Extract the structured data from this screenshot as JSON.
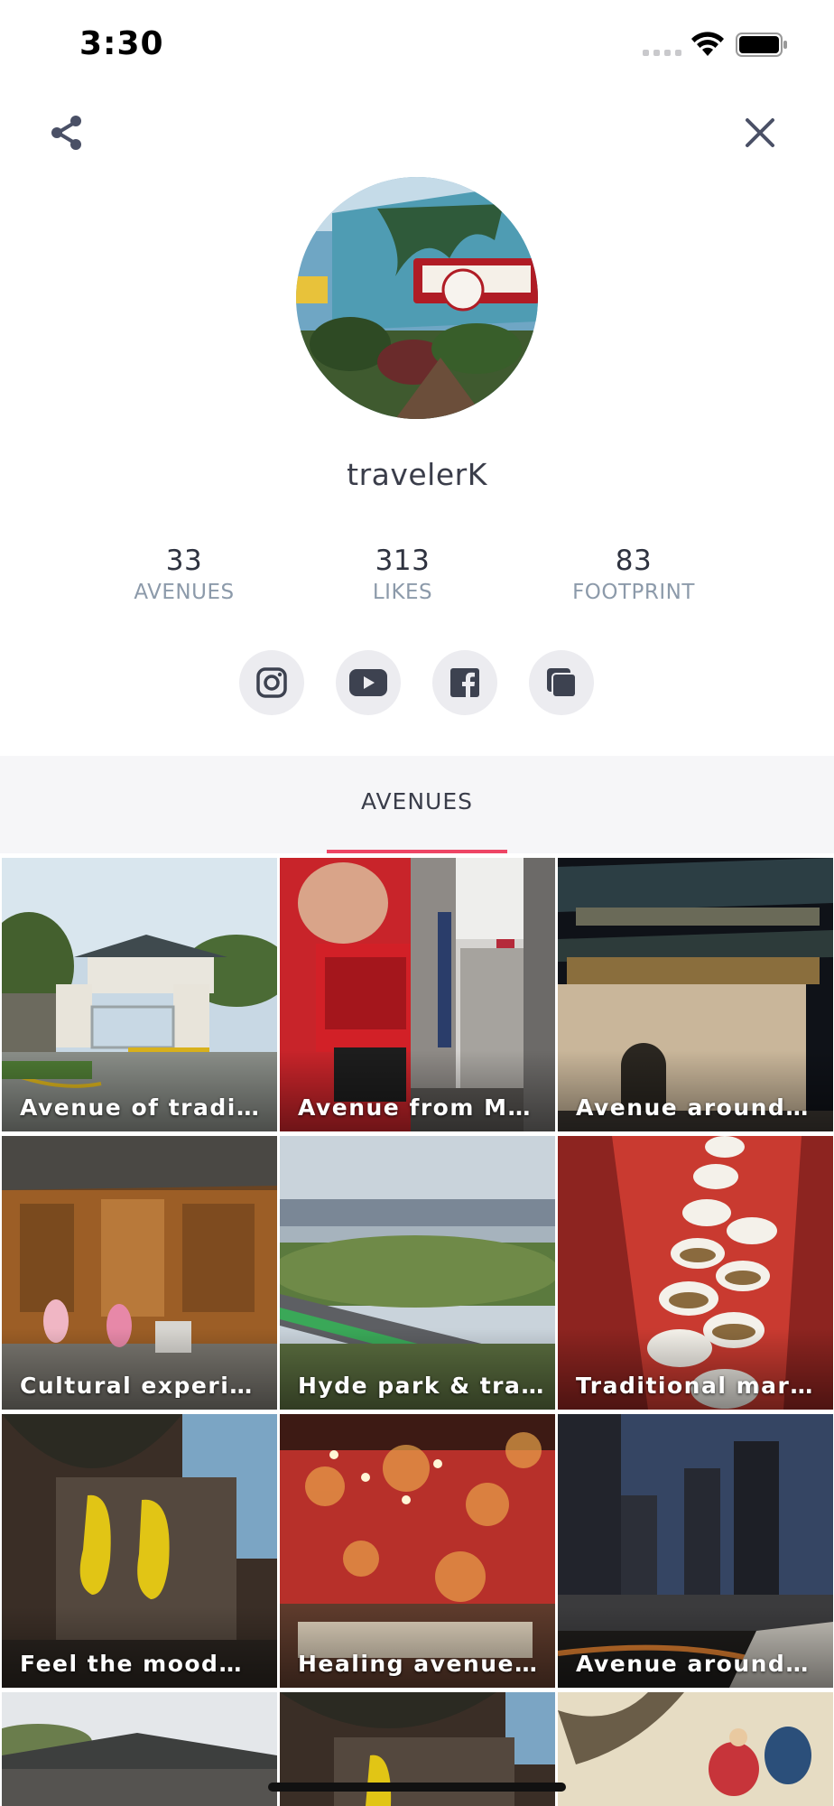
{
  "status_bar": {
    "time": "3:30"
  },
  "profile": {
    "username": "travelerK",
    "stats": [
      {
        "value": "33",
        "label": "AVENUES"
      },
      {
        "value": "313",
        "label": "LIKES"
      },
      {
        "value": "83",
        "label": "FOOTPRINT"
      }
    ]
  },
  "socials": [
    "instagram-icon",
    "youtube-icon",
    "facebook-icon",
    "blog-icon"
  ],
  "tabs": {
    "active_label": "AVENUES",
    "accent_color": "#ee4565"
  },
  "avenues": [
    {
      "title": "Avenue of tradi…"
    },
    {
      "title": "Avenue from M…"
    },
    {
      "title": "Avenue around…"
    },
    {
      "title": "Cultural experi…"
    },
    {
      "title": "Hyde park & tra…"
    },
    {
      "title": "Traditional mar…"
    },
    {
      "title": "Feel the mood…"
    },
    {
      "title": "Healing avenue…"
    },
    {
      "title": "Avenue around…"
    }
  ]
}
